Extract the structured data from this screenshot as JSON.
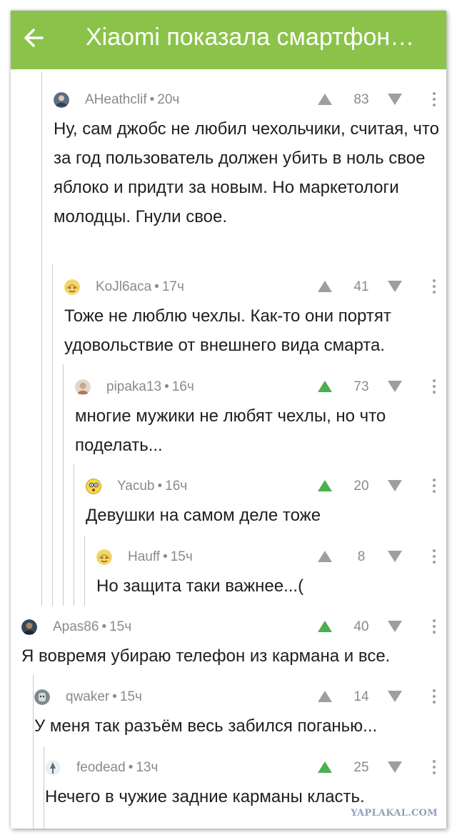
{
  "header": {
    "title": "Xiaomi показала смартфон…",
    "back_icon": "arrow-left-icon",
    "bar_color": "#8bc34a"
  },
  "colors": {
    "vote_up_active": "#4caf50",
    "vote_inactive": "#9e9e9e",
    "meta_text": "#8a8a8a"
  },
  "comments": [
    {
      "author": "AHeathclif",
      "time": "20ч",
      "rating": "83",
      "voted_up": false,
      "avatar_icon": "user-avatar-icon",
      "text": "Ну, сам джобс не любил чехольчики, считая, что за год пользователь должен убить в ноль свое яблоко и придти за новым. Но маркетологи молодцы. Гнули свое."
    },
    {
      "author": "KoJl6aca",
      "time": "17ч",
      "rating": "41",
      "voted_up": false,
      "avatar_icon": "smiley-avatar-icon",
      "text": "Тоже не люблю чехлы. Как-то они портят удовольствие от внешнего вида смарта."
    },
    {
      "author": "pipaka13",
      "time": "16ч",
      "rating": "73",
      "voted_up": true,
      "avatar_icon": "user-avatar-icon",
      "text": "многие мужики не любят чехлы, но что поделать..."
    },
    {
      "author": "Yacub",
      "time": "16ч",
      "rating": "20",
      "voted_up": true,
      "avatar_icon": "smiley-avatar-icon",
      "text": "Девушки на самом деле тоже"
    },
    {
      "author": "Hauff",
      "time": "15ч",
      "rating": "8",
      "voted_up": false,
      "avatar_icon": "smiley-avatar-icon",
      "text": "Но защита таки важнее...("
    },
    {
      "author": "Apas86",
      "time": "15ч",
      "rating": "40",
      "voted_up": true,
      "avatar_icon": "user-avatar-icon",
      "text": "Я вовремя убираю телефон из кармана и все."
    },
    {
      "author": "qwaker",
      "time": "15ч",
      "rating": "14",
      "voted_up": false,
      "avatar_icon": "user-avatar-icon",
      "text": "У меня так разъём весь забился поганью..."
    },
    {
      "author": "feodead",
      "time": "13ч",
      "rating": "25",
      "voted_up": true,
      "avatar_icon": "user-avatar-icon",
      "text": "Нечего в чужие задние карманы класть."
    }
  ],
  "watermark": "YAPLAKAL.COM"
}
